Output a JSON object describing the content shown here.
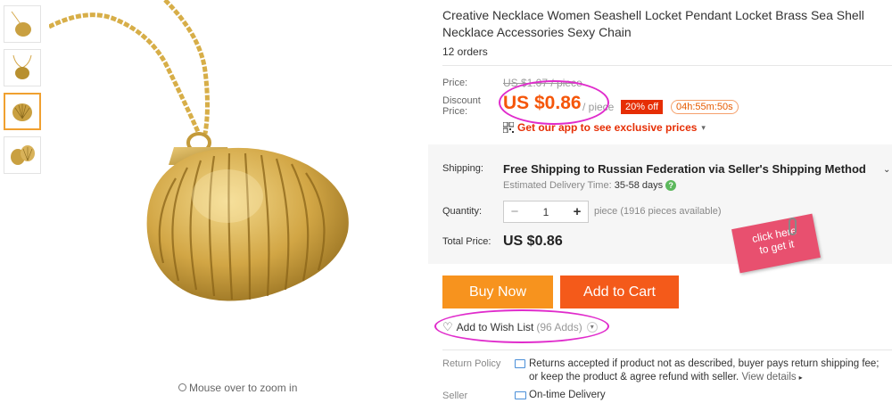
{
  "product": {
    "title": "Creative Necklace Women Seashell Locket Pendant Locket Brass Sea Shell Necklace Accessories Sexy Chain",
    "orders": "12 orders"
  },
  "gallery": {
    "zoom_hint": "Mouse over to zoom in",
    "thumbnails": [
      "thumb-1",
      "thumb-2",
      "thumb-3",
      "thumb-4"
    ],
    "active_index": 2
  },
  "pricing": {
    "price_label": "Price:",
    "original_price": "US $1.07 / piece",
    "discount_label": "Discount Price:",
    "discount_price": "US $0.86",
    "per_unit": "/ piece",
    "off_badge": "20% off",
    "timer": "04h:55m:50s",
    "app_promo": "Get our app to see exclusive prices"
  },
  "shipping": {
    "label": "Shipping:",
    "text": "Free Shipping to Russian Federation via Seller's Shipping Method",
    "estimate_label": "Estimated Delivery Time:",
    "estimate_value": "35-58 days"
  },
  "quantity": {
    "label": "Quantity:",
    "value": "1",
    "minus": "−",
    "plus": "+",
    "available": "piece (1916 pieces available)"
  },
  "total": {
    "label": "Total Price:",
    "value": "US $0.86"
  },
  "sticker": {
    "line1": "click here",
    "line2": "to get it"
  },
  "actions": {
    "buy_now": "Buy Now",
    "add_to_cart": "Add to Cart",
    "wishlist": "Add to Wish List",
    "wishlist_count": "(96 Adds)"
  },
  "policy": {
    "return_label": "Return Policy",
    "return_text": "Returns accepted if product not as described, buyer pays return shipping fee; or keep the product & agree refund with seller.",
    "view_details": "View details",
    "seller_label": "Seller",
    "seller_text": "On-time Delivery"
  },
  "colors": {
    "buy_now": "#f7931e",
    "add_to_cart": "#f45a1a",
    "discount_price": "#f5560a",
    "annotation_circle": "#e02ccc",
    "sticker": "#e8506f"
  }
}
